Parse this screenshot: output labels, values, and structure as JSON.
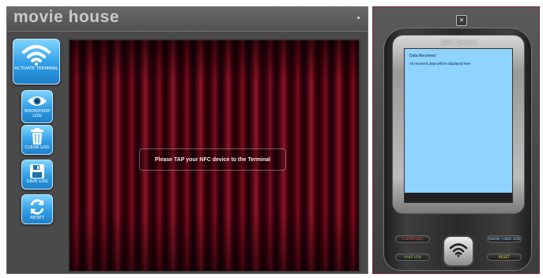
{
  "app": {
    "title": "movie house",
    "buttons": [
      {
        "label": "ACTIVATE TERMINAL",
        "icon": "wifi-icon"
      },
      {
        "label": "SHOW/HIDE LOG",
        "icon": "eye-icon"
      },
      {
        "label": "CLEAR LOG",
        "icon": "trash-icon"
      },
      {
        "label": "SAVE LOG",
        "icon": "floppy-disk-icon"
      },
      {
        "label": "RESET",
        "icon": "refresh-icon"
      }
    ],
    "stage": {
      "prompt": "Please TAP your NFC device to the Terminal"
    }
  },
  "device": {
    "name": "NFC Device",
    "screen": {
      "heading": "Data Received :",
      "message": "All received data will be displayed here"
    },
    "buttons": {
      "clear_log": "CLEAR LOG",
      "show_hide_log": "SHOW / HIDE LOG",
      "save_log": "SAVE LOG",
      "reset": "RESET"
    },
    "close_icon": "close-icon",
    "center_key_icon": "wifi-icon"
  },
  "colors": {
    "button_blue": "#2f9ee6",
    "screen_blue": "#8fd3ff",
    "curtain_red": "#7a0d1e",
    "clear_log_text": "#ff4b4b",
    "show_hide_text": "#9fd4ff",
    "save_log_text": "#8fd36a",
    "reset_text": "#f2d43a"
  }
}
